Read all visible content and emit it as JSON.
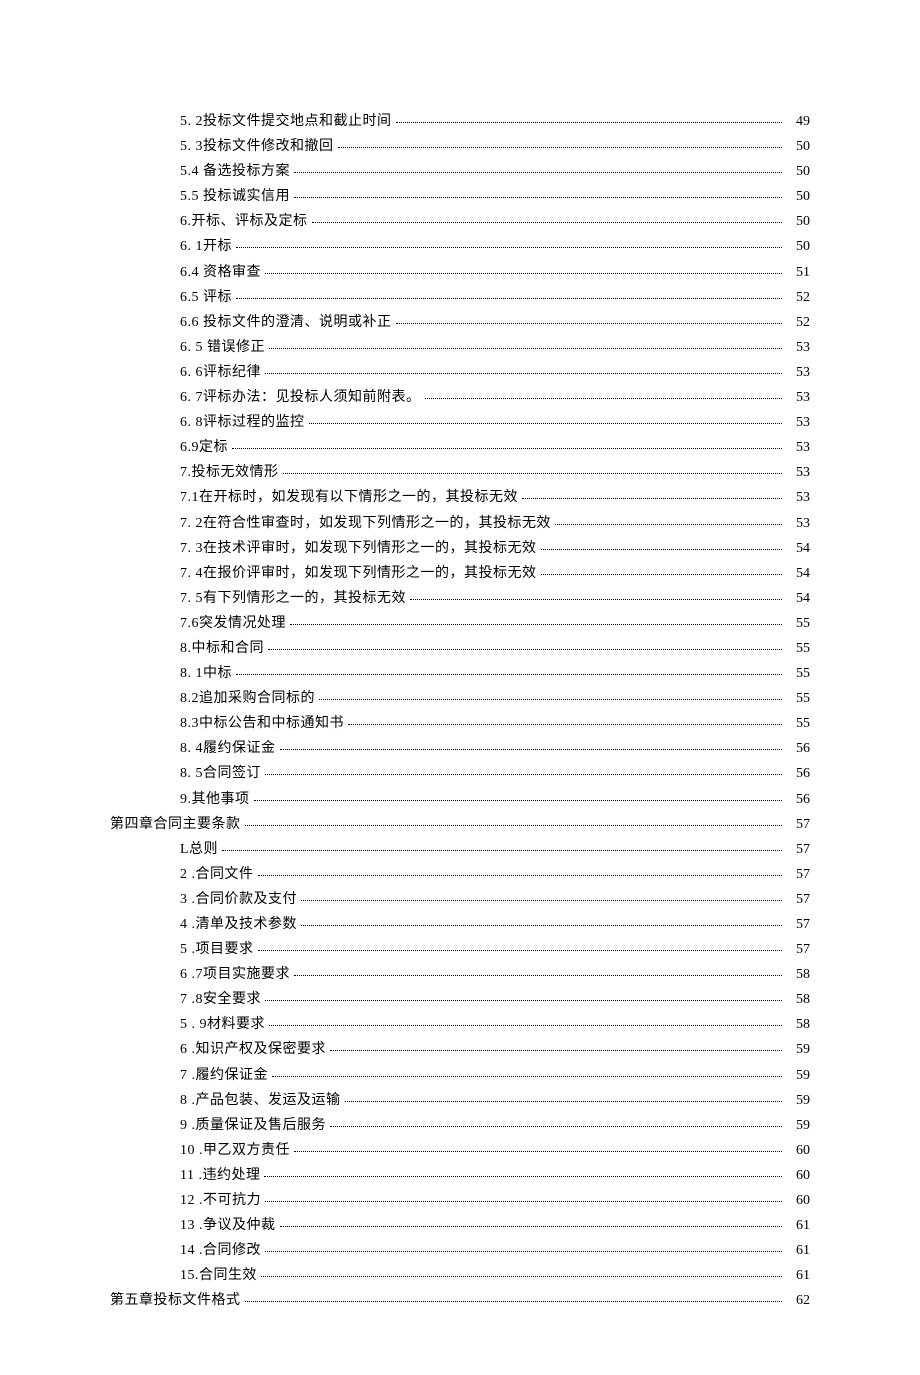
{
  "toc": [
    {
      "indent": 1,
      "label": "5.  2投标文件提交地点和截止时间",
      "page": "49"
    },
    {
      "indent": 1,
      "label": "5.  3投标文件修改和撤回",
      "page": "50"
    },
    {
      "indent": 1,
      "label": "5.4  备选投标方案",
      "page": "50"
    },
    {
      "indent": 1,
      "label": "5.5  投标诚实信用",
      "page": "50"
    },
    {
      "indent": 1,
      "label": "6.开标、评标及定标",
      "page": "50"
    },
    {
      "indent": 1,
      "label": "6.  1开标",
      "page": "50"
    },
    {
      "indent": 1,
      "label": "6.4  资格审查",
      "page": "51"
    },
    {
      "indent": 1,
      "label": "6.5  评标",
      "page": "52"
    },
    {
      "indent": 1,
      "label": "6.6  投标文件的澄清、说明或补正",
      "page": "52"
    },
    {
      "indent": 1,
      "label": "6.  5 错误修正",
      "page": "53"
    },
    {
      "indent": 1,
      "label": "6.  6评标纪律",
      "page": "53"
    },
    {
      "indent": 1,
      "label": "6.  7评标办法：见投标人须知前附表。",
      "page": "53"
    },
    {
      "indent": 1,
      "label": "6.  8评标过程的监控",
      "page": "53"
    },
    {
      "indent": 1,
      "label": "6.9定标",
      "page": "53"
    },
    {
      "indent": 1,
      "label": "7.投标无效情形",
      "page": "53"
    },
    {
      "indent": 1,
      "label": "7.1在开标时，如发现有以下情形之一的，其投标无效",
      "page": "53"
    },
    {
      "indent": 1,
      "label": "7.  2在符合性审查时，如发现下列情形之一的，其投标无效",
      "page": "53"
    },
    {
      "indent": 1,
      "label": "7.  3在技术评审时，如发现下列情形之一的，其投标无效",
      "page": "54"
    },
    {
      "indent": 1,
      "label": "7.  4在报价评审时，如发现下列情形之一的，其投标无效",
      "page": "54"
    },
    {
      "indent": 1,
      "label": "7.  5有下列情形之一的，其投标无效",
      "page": "54"
    },
    {
      "indent": 1,
      "label": "7.6突发情况处理",
      "page": "55"
    },
    {
      "indent": 1,
      "label": "8.中标和合同",
      "page": "55"
    },
    {
      "indent": 1,
      "label": "8.  1中标",
      "page": "55"
    },
    {
      "indent": 1,
      "label": "8.2追加采购合同标的",
      "page": "55"
    },
    {
      "indent": 1,
      "label": "8.3中标公告和中标通知书",
      "page": "55"
    },
    {
      "indent": 1,
      "label": "8.  4履约保证金",
      "page": "56"
    },
    {
      "indent": 1,
      "label": "8.  5合同签订",
      "page": "56"
    },
    {
      "indent": 1,
      "label": "9.其他事项",
      "page": "56"
    },
    {
      "indent": 0,
      "label": "第四章合同主要条款",
      "page": "57"
    },
    {
      "indent": 1,
      "label": "L总则",
      "page": "57"
    },
    {
      "indent": 1,
      "label": "2  .合同文件",
      "page": "57"
    },
    {
      "indent": 1,
      "label": "3  .合同价款及支付",
      "page": "57"
    },
    {
      "indent": 1,
      "label": "4  .清单及技术参数",
      "page": "57"
    },
    {
      "indent": 1,
      "label": "5  .项目要求",
      "page": "57"
    },
    {
      "indent": 1,
      "label": "6  .7项目实施要求",
      "page": "58"
    },
    {
      "indent": 1,
      "label": "7  .8安全要求",
      "page": "58"
    },
    {
      "indent": 1,
      "label": "5  . 9材料要求",
      "page": "58"
    },
    {
      "indent": 1,
      "label": "6  .知识产权及保密要求",
      "page": "59"
    },
    {
      "indent": 1,
      "label": "7  .履约保证金",
      "page": "59"
    },
    {
      "indent": 1,
      "label": "8  .产品包装、发运及运输",
      "page": "59"
    },
    {
      "indent": 1,
      "label": "9  .质量保证及售后服务",
      "page": "59"
    },
    {
      "indent": 1,
      "label": "10  .甲乙双方责任",
      "page": "60"
    },
    {
      "indent": 1,
      "label": "11  .违约处理",
      "page": "60"
    },
    {
      "indent": 1,
      "label": "12  .不可抗力",
      "page": "60"
    },
    {
      "indent": 1,
      "label": "13  .争议及仲裁",
      "page": "61"
    },
    {
      "indent": 1,
      "label": "14  .合同修改",
      "page": "61"
    },
    {
      "indent": 1,
      "label": "15.合同生效",
      "page": "61"
    },
    {
      "indent": 0,
      "label": "第五章投标文件格式",
      "page": "62"
    }
  ]
}
